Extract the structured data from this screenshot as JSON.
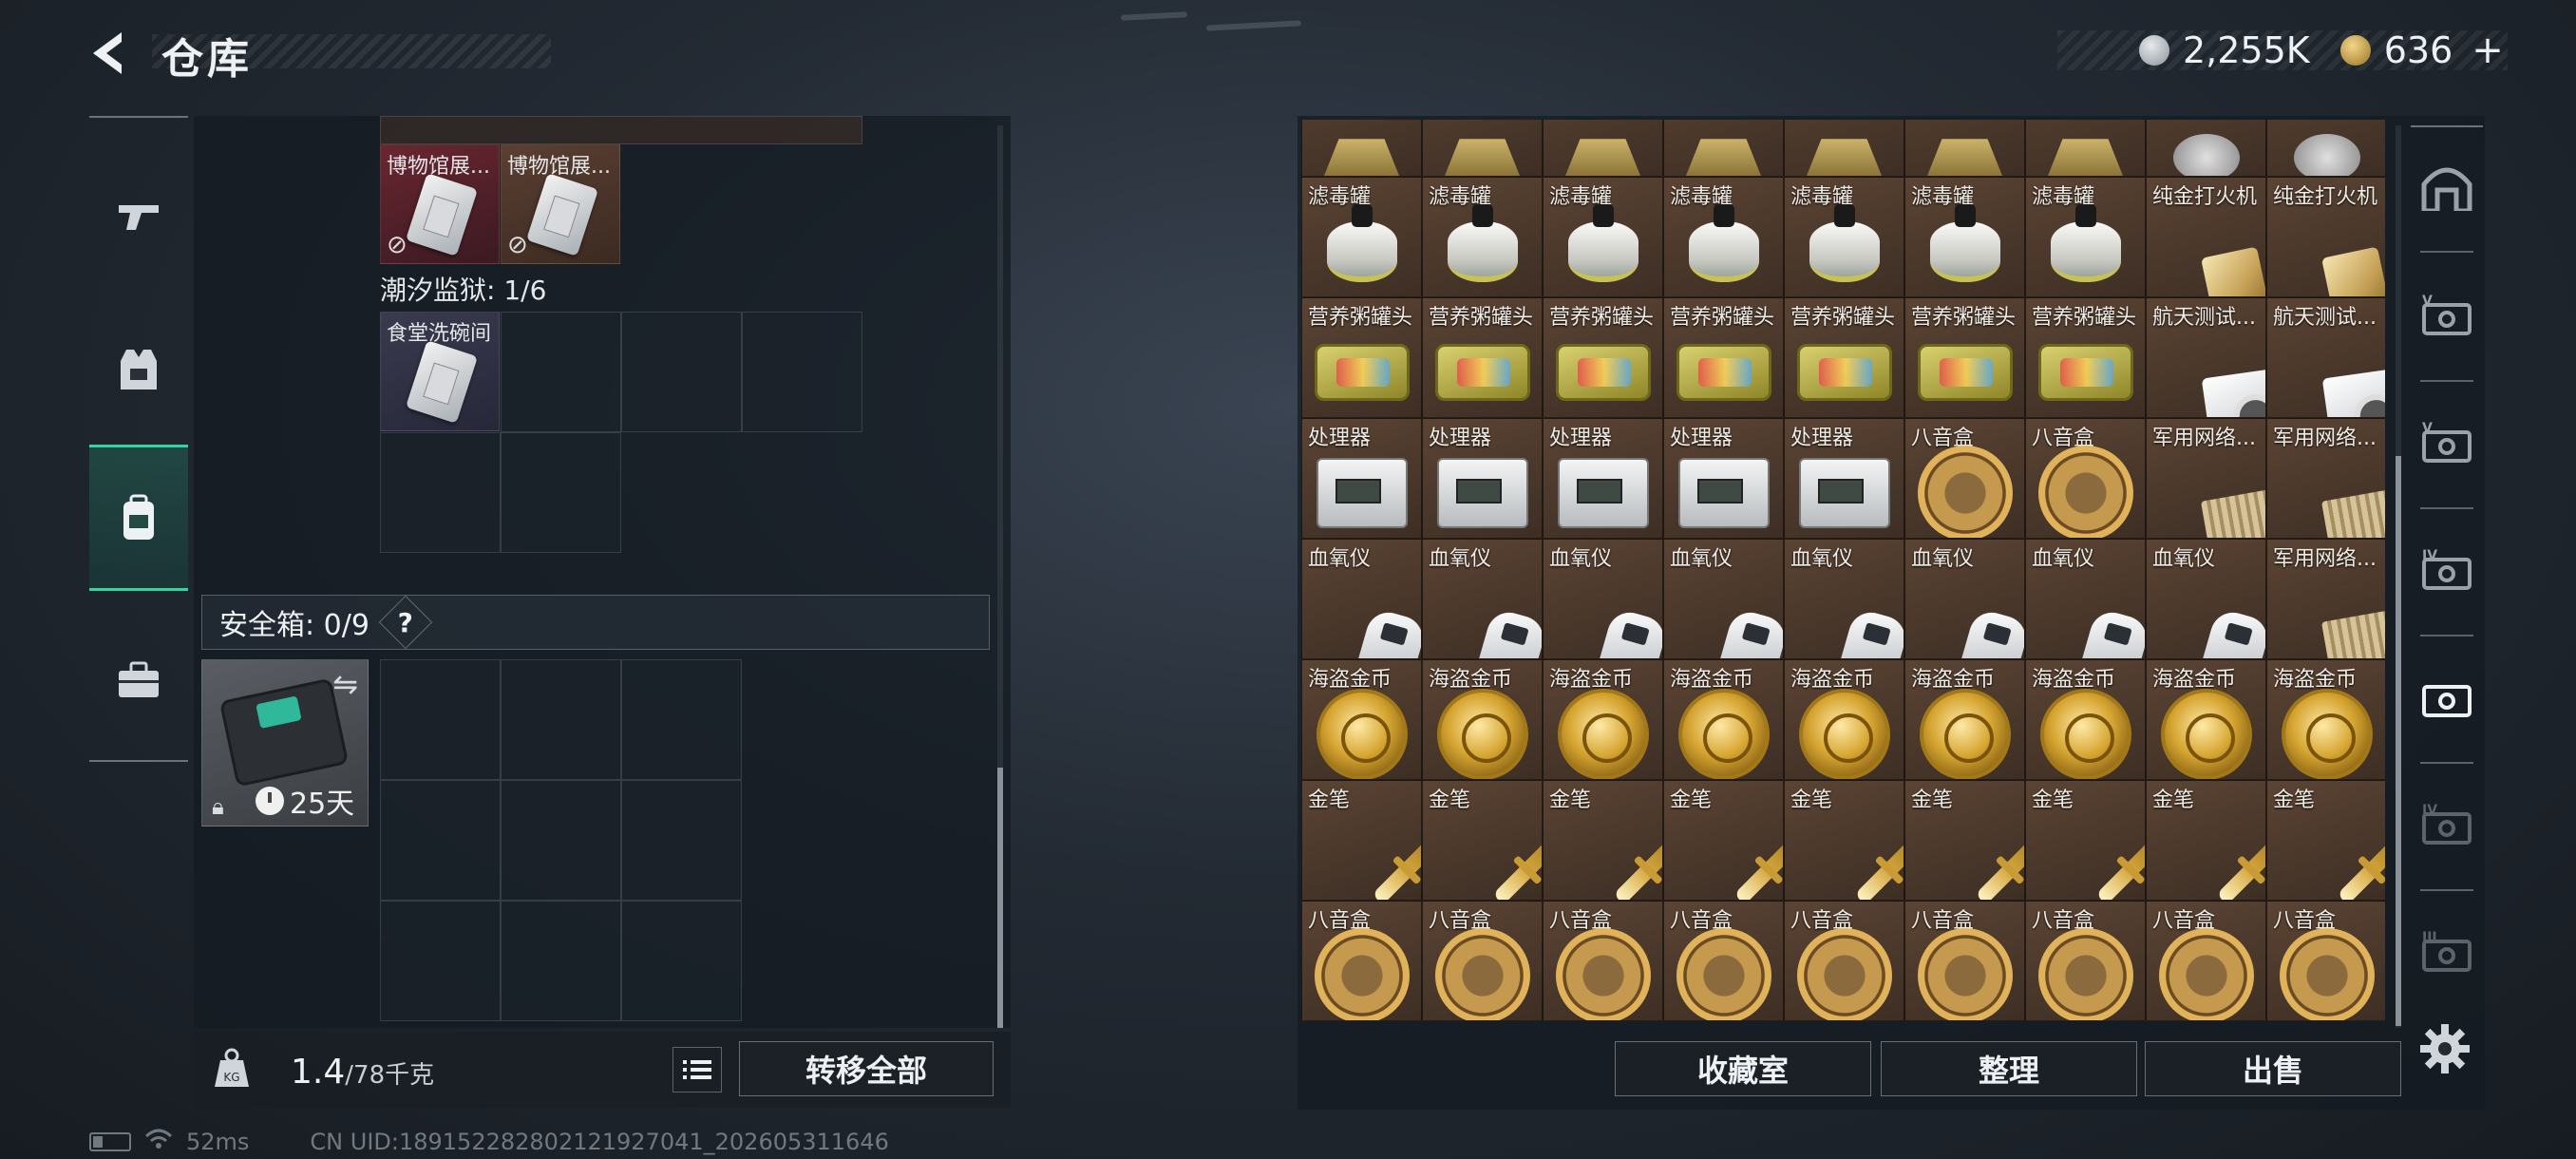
{
  "header": {
    "title": "仓库"
  },
  "currency": {
    "silver": "2,255K",
    "gold": "636",
    "plus": "+"
  },
  "left_nav": {
    "items": [
      {
        "id": "weapon"
      },
      {
        "id": "gear"
      },
      {
        "id": "backpack",
        "active": true
      },
      {
        "id": "case"
      }
    ]
  },
  "backpack": {
    "museum_items": [
      {
        "name": "博物馆展..."
      },
      {
        "name": "博物馆展..."
      }
    ],
    "tidal_prison_label": "潮汐监狱: 1/6",
    "tidal_prison_items": [
      {
        "name": "食堂洗碗间"
      }
    ],
    "safe_label": "安全箱: 0/9",
    "help": "?",
    "safe_timer": "25天",
    "weight_value": "1.4",
    "weight_capacity": "/78千克",
    "transfer_all": "转移全部"
  },
  "stash": {
    "rows": [
      [
        "滤毒罐",
        "滤毒罐",
        "滤毒罐",
        "滤毒罐",
        "滤毒罐",
        "滤毒罐",
        "滤毒罐",
        "纯金打火机",
        "纯金打火机"
      ],
      [
        "营养粥罐头",
        "营养粥罐头",
        "营养粥罐头",
        "营养粥罐头",
        "营养粥罐头",
        "营养粥罐头",
        "营养粥罐头",
        "航天测试...",
        "航天测试..."
      ],
      [
        "处理器",
        "处理器",
        "处理器",
        "处理器",
        "处理器",
        "八音盒",
        "八音盒",
        "军用网络...",
        "军用网络..."
      ],
      [
        "血氧仪",
        "血氧仪",
        "血氧仪",
        "血氧仪",
        "血氧仪",
        "血氧仪",
        "血氧仪",
        "血氧仪",
        "军用网络..."
      ],
      [
        "海盗金币",
        "海盗金币",
        "海盗金币",
        "海盗金币",
        "海盗金币",
        "海盗金币",
        "海盗金币",
        "海盗金币",
        "海盗金币"
      ],
      [
        "金笔",
        "金笔",
        "金笔",
        "金笔",
        "金笔",
        "金笔",
        "金笔",
        "金笔",
        "金笔"
      ],
      [
        "八音盒",
        "八音盒",
        "八音盒",
        "八音盒",
        "八音盒",
        "八音盒",
        "八音盒",
        "八音盒",
        "八音盒"
      ]
    ],
    "collection_button": "收藏室",
    "sort_button": "整理",
    "sell_button": "出售"
  },
  "right_rail": {
    "tiers": [
      "",
      "V",
      "V",
      "IV",
      "",
      "IV",
      "III"
    ]
  },
  "status": {
    "ping": "52ms",
    "uid": "CN UID:1891522828021219270​41_202605311646"
  }
}
